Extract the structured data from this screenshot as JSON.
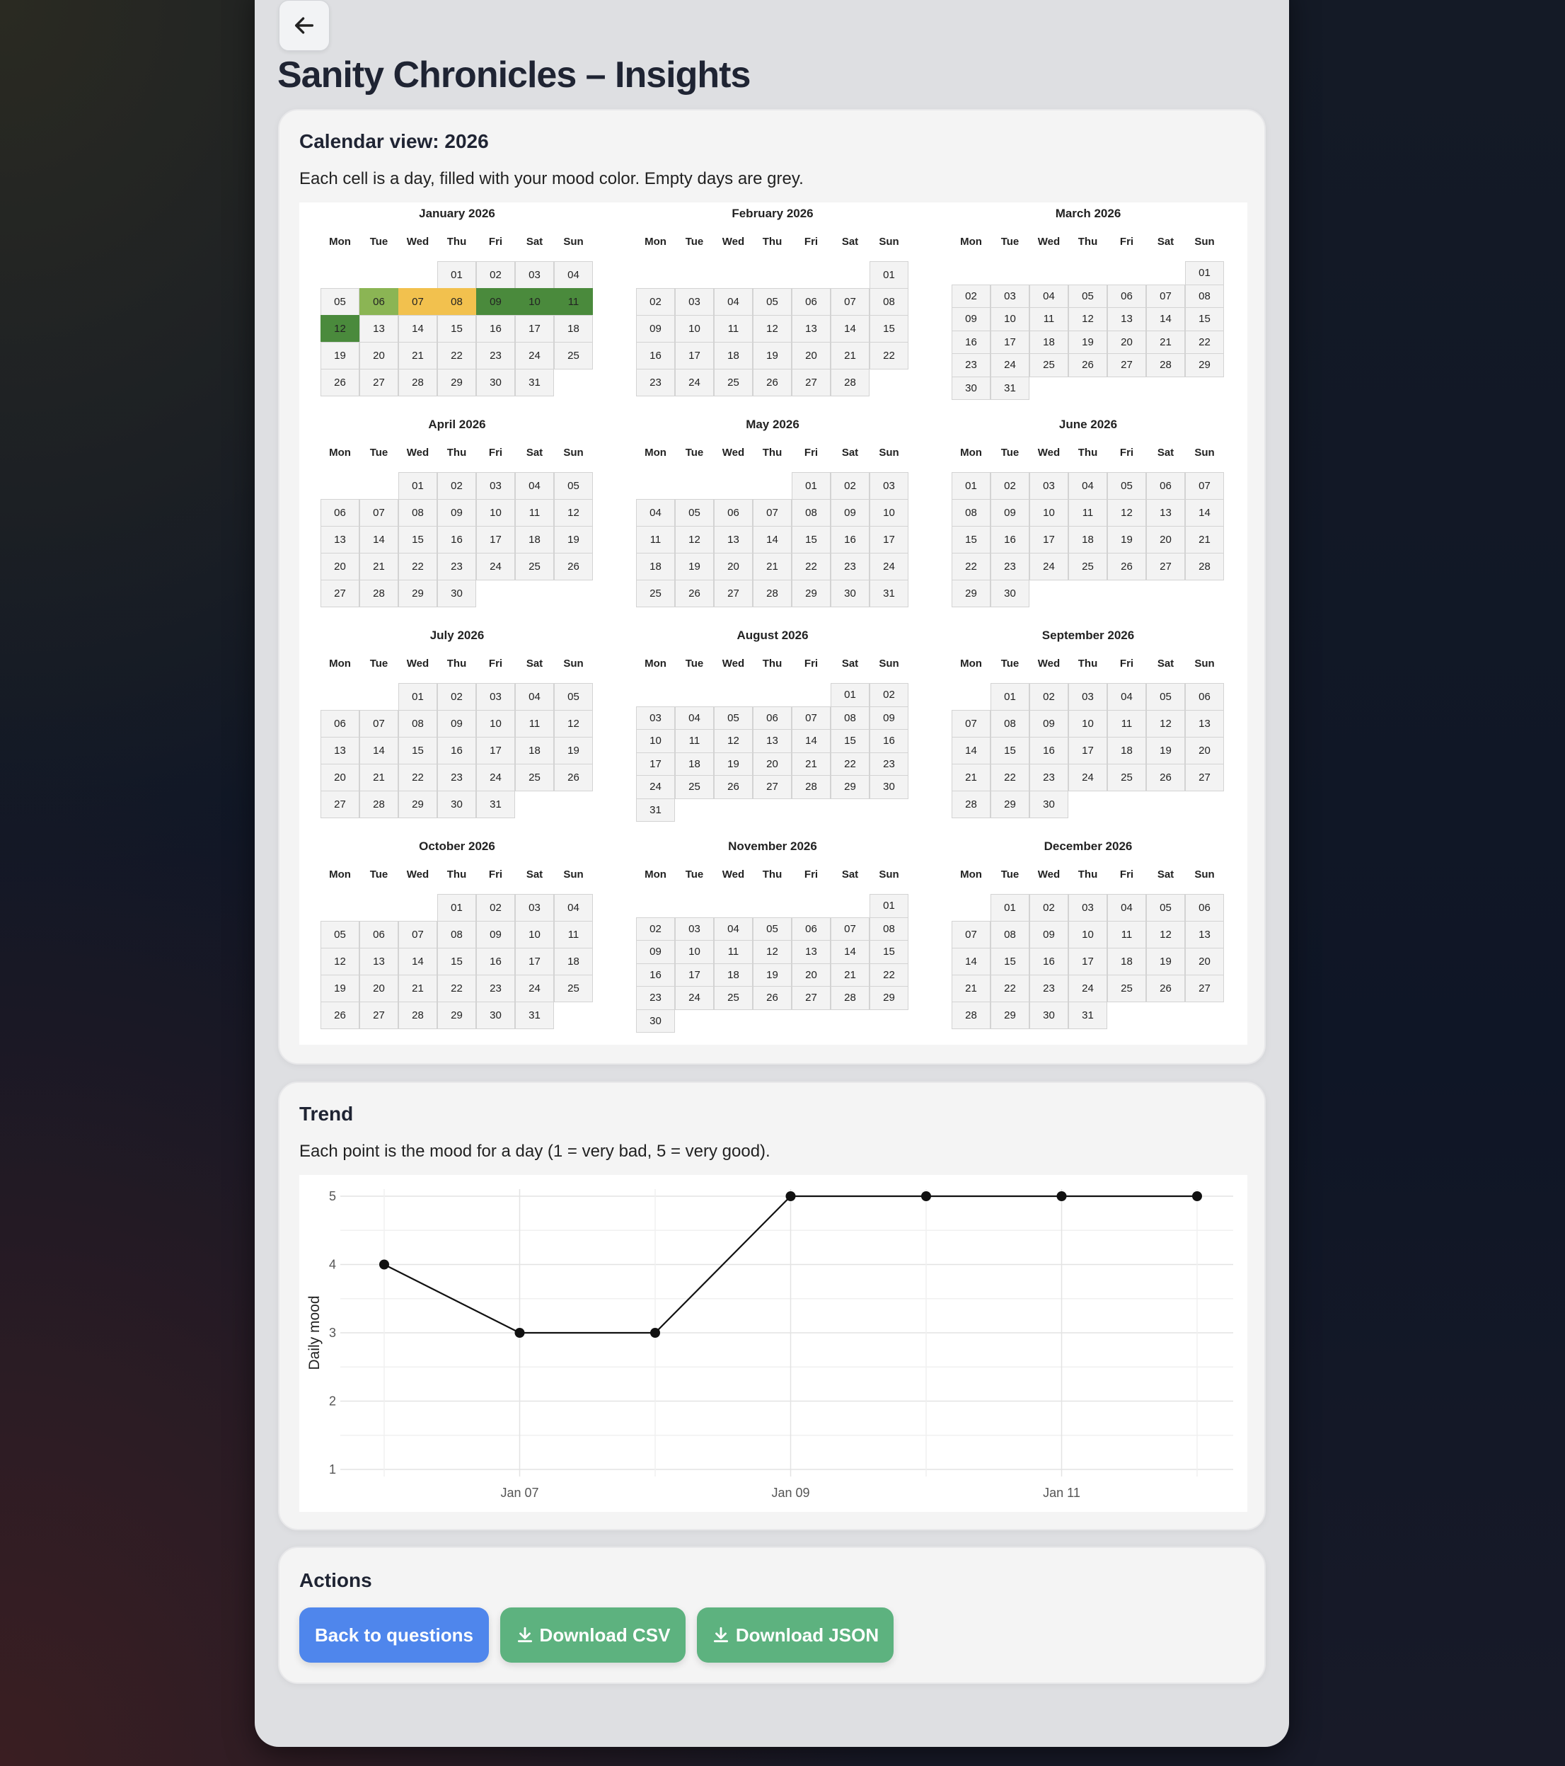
{
  "page": {
    "title": "Sanity Chronicles – Insights"
  },
  "calendar": {
    "heading": "Calendar view: 2026",
    "description": "Each cell is a day, filled with your mood color. Empty days are grey.",
    "year": 2026,
    "weekdays": [
      "Mon",
      "Tue",
      "Wed",
      "Thu",
      "Fri",
      "Sat",
      "Sun"
    ],
    "months": [
      {
        "name": "January 2026",
        "first_weekday": 3,
        "days": 31
      },
      {
        "name": "February 2026",
        "first_weekday": 6,
        "days": 28
      },
      {
        "name": "March 2026",
        "first_weekday": 6,
        "days": 31
      },
      {
        "name": "April 2026",
        "first_weekday": 2,
        "days": 30
      },
      {
        "name": "May 2026",
        "first_weekday": 4,
        "days": 31
      },
      {
        "name": "June 2026",
        "first_weekday": 0,
        "days": 30
      },
      {
        "name": "July 2026",
        "first_weekday": 2,
        "days": 31
      },
      {
        "name": "August 2026",
        "first_weekday": 5,
        "days": 31
      },
      {
        "name": "September 2026",
        "first_weekday": 1,
        "days": 30
      },
      {
        "name": "October 2026",
        "first_weekday": 3,
        "days": 31
      },
      {
        "name": "November 2026",
        "first_weekday": 6,
        "days": 30
      },
      {
        "name": "December 2026",
        "first_weekday": 1,
        "days": 31
      }
    ],
    "mood_days": [
      {
        "month": 0,
        "day": 6,
        "color": "#8bb554"
      },
      {
        "month": 0,
        "day": 7,
        "color": "#f2c14e"
      },
      {
        "month": 0,
        "day": 8,
        "color": "#f2c14e"
      },
      {
        "month": 0,
        "day": 9,
        "color": "#4a8a3c"
      },
      {
        "month": 0,
        "day": 10,
        "color": "#4a8a3c"
      },
      {
        "month": 0,
        "day": 11,
        "color": "#4a8a3c"
      },
      {
        "month": 0,
        "day": 12,
        "color": "#4a8a3c"
      }
    ]
  },
  "trend": {
    "heading": "Trend",
    "description": "Each point is the mood for a day (1 = very bad, 5 = very good)."
  },
  "chart_data": {
    "type": "line",
    "x": [
      "2026-01-06",
      "2026-01-07",
      "2026-01-08",
      "2026-01-09",
      "2026-01-10",
      "2026-01-11",
      "2026-01-12"
    ],
    "x_tick_labels": [
      "Jan 07",
      "Jan 09",
      "Jan 11"
    ],
    "x_tick_indices": [
      1,
      3,
      5
    ],
    "series": [
      {
        "values": [
          4,
          3,
          3,
          5,
          5,
          5,
          5
        ]
      }
    ],
    "ylabel": "Daily mood",
    "ylim": [
      1,
      5
    ],
    "y_ticks": [
      "1",
      "2",
      "3",
      "4",
      "5"
    ],
    "grid": true,
    "line_color": "#111111"
  },
  "actions": {
    "heading": "Actions",
    "back_label": "Back to questions",
    "csv_label": "Download CSV",
    "json_label": "Download JSON",
    "primary_color": "#4f86ec",
    "download_color": "#5db27f"
  },
  "icons": {
    "back": "arrow-left-icon",
    "download": "download-icon"
  }
}
